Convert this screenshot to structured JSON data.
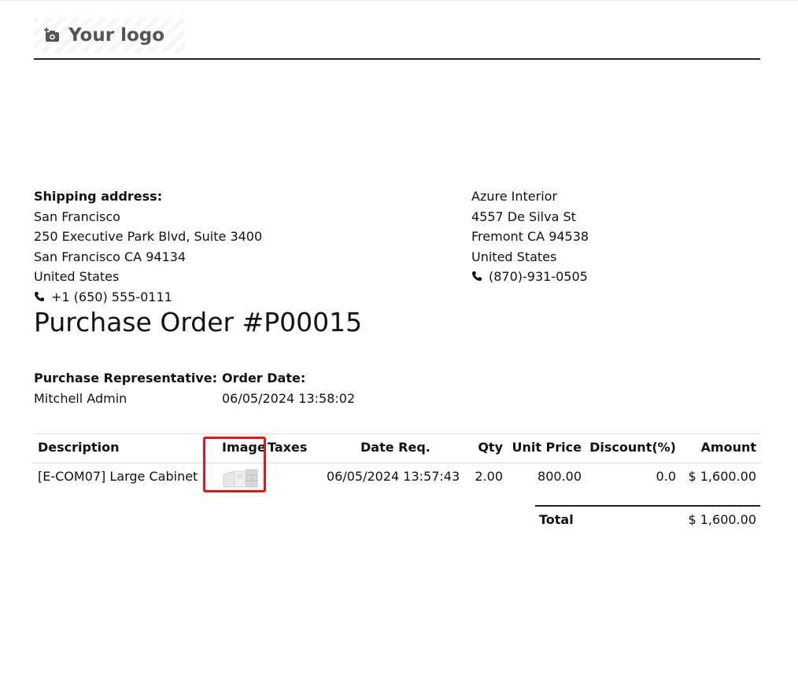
{
  "logo": {
    "icon": "camera-plus-icon",
    "text": "Your logo"
  },
  "shipping": {
    "label": "Shipping address:",
    "name": "San Francisco",
    "street": "250 Executive Park Blvd, Suite 3400",
    "city": "San Francisco CA 94134",
    "country": "United States",
    "phone": "+1 (650) 555-0111"
  },
  "vendor": {
    "name": "Azure Interior",
    "street": "4557 De Silva St",
    "city": "Fremont CA 94538",
    "country": "United States",
    "phone": "(870)-931-0505"
  },
  "title": "Purchase Order #P00015",
  "representative": {
    "label": "Purchase Representative:",
    "value": "Mitchell Admin"
  },
  "order_date": {
    "label": "Order Date:",
    "value": "06/05/2024 13:58:02"
  },
  "table": {
    "headers": {
      "description": "Description",
      "image": "Image",
      "taxes": "Taxes",
      "date_req": "Date Req.",
      "qty": "Qty",
      "unit_price": "Unit Price",
      "discount": "Discount(%)",
      "amount": "Amount"
    },
    "rows": [
      {
        "description": "[E-COM07] Large Cabinet",
        "image": "cabinet-thumbnail",
        "taxes": "",
        "date_req": "06/05/2024 13:57:43",
        "qty": "2.00",
        "unit_price": "800.00",
        "discount": "0.0",
        "amount": "$ 1,600.00"
      }
    ]
  },
  "total": {
    "label": "Total",
    "value": "$ 1,600.00"
  },
  "colors": {
    "highlight": "#e8141c",
    "rule": "#222222"
  }
}
